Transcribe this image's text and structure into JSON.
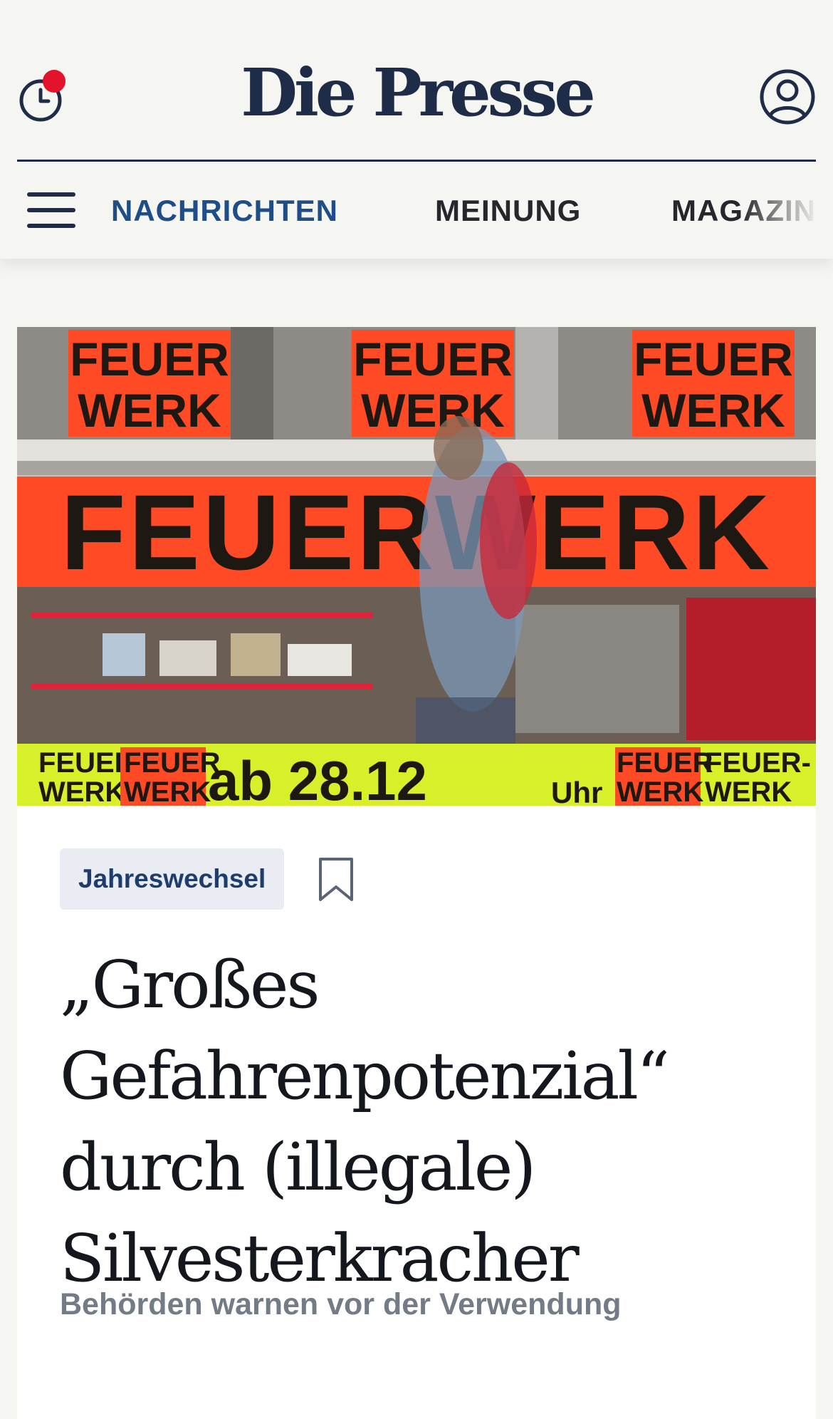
{
  "header": {
    "logo": "Die Presse",
    "history_icon": "clock-icon",
    "notification_indicator": "red-dot",
    "account_icon": "user-icon"
  },
  "nav": {
    "menu_icon": "hamburger-icon",
    "items": [
      {
        "label": "NACHRICHTEN",
        "active": true
      },
      {
        "label": "MEINUNG",
        "active": false
      },
      {
        "label": "MAGAZIN",
        "active": false
      }
    ]
  },
  "article": {
    "hero_signs": {
      "small": "FEUER WERK",
      "large": "FEUERWERK",
      "bottom_left_1": "FEUER-WERK",
      "bottom_left_2": "FEUER WERK",
      "date": "ab 28.12",
      "time": "Uhr",
      "bottom_right_1": "FEUER WERK",
      "bottom_right_2": "FEUER-WERK"
    },
    "tag": "Jahreswechsel",
    "bookmark_icon": "bookmark-icon",
    "headline": "„Großes Gefahrenpotenzial“ durch (illegale) Silvesterkracher",
    "lead": "Behörden warnen vor der Verwendung"
  },
  "colors": {
    "brand_navy": "#1e2c47",
    "nav_active": "#1f4d87",
    "notification": "#e3132b",
    "tag_bg": "#e9edf3",
    "sign_orange": "#ff4a26",
    "sign_yellow": "#d8f02a"
  }
}
